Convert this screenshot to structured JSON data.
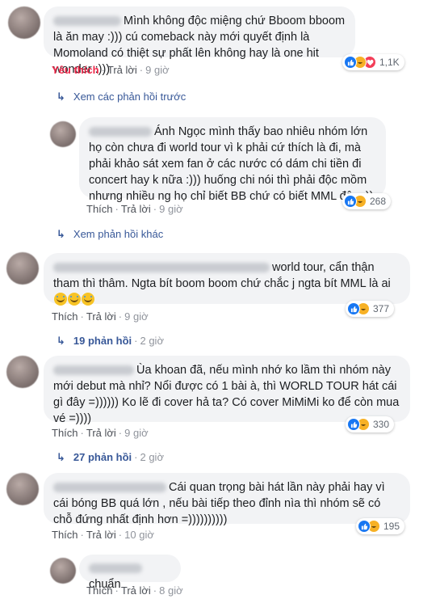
{
  "comments": [
    {
      "text": "Mình không độc miệng chứ Bboom bboom là ăn may :))) cú comeback này mới quyết định là Momoland có thiệt sự phất lên không hay là one hit wonder :)))",
      "actions": {
        "like": "Yêu thích",
        "reply": "Trả lời",
        "time": "9 giờ"
      },
      "reaction_count": "1,1K",
      "reaction_icons": [
        "like-icon",
        "haha-icon",
        "love-icon"
      ]
    },
    {
      "view_previous": "Xem các phản hồi trước"
    },
    {
      "text": "Ánh Ngọc mình thấy bao nhiêu nhóm lớn họ còn chưa đi world tour vì k phải cứ thích là đi, mà phải khảo sát xem fan ở các nước có dám chi tiền đi concert hay k nữa :))) huống chi nói thì phải độc mồm nhưng nhiều ng họ chỉ biết BB chứ có biết MML đâu :))",
      "actions": {
        "like": "Thích",
        "reply": "Trả lời",
        "time": "9 giờ"
      },
      "reaction_count": "268",
      "reaction_icons": [
        "like-icon",
        "haha-icon"
      ]
    },
    {
      "view_more": "Xem phản hồi khác"
    },
    {
      "text": "world tour, cẩn thận tham thì thâm. Ngta bít boom boom chứ chắc j ngta bít MML là ai",
      "actions": {
        "like": "Thích",
        "reply": "Trả lời",
        "time": "9 giờ"
      },
      "reaction_count": "377",
      "reaction_icons": [
        "like-icon",
        "haha-icon"
      ],
      "replies": {
        "label": "19 phản hồi",
        "time": "2 giờ"
      }
    },
    {
      "text": "Ùa khoan đã, nếu mình nhớ ko lầm thì nhóm này mới debut mà nhỉ? Nổi được có 1 bài à, thì WORLD TOUR hát cái gì đây =)))))) Ko lẽ đi cover hả ta? Có cover MiMiMi ko để còn mua vé =))))",
      "actions": {
        "like": "Thích",
        "reply": "Trả lời",
        "time": "9 giờ"
      },
      "reaction_count": "330",
      "reaction_icons": [
        "like-icon",
        "haha-icon"
      ],
      "replies": {
        "label": "27 phản hồi",
        "time": "2 giờ"
      }
    },
    {
      "text": "Cái quan trọng bài hát lần này phải hay vì cái bóng BB quá lớn , nếu bài tiếp theo đỉnh nìa thì nhóm sẽ có chỗ đứng nhất định hơn =))))))))))",
      "actions": {
        "like": "Thích",
        "reply": "Trả lời",
        "time": "10 giờ"
      },
      "reaction_count": "195",
      "reaction_icons": [
        "like-icon",
        "haha-icon"
      ]
    },
    {
      "text": "chuẩn",
      "actions": {
        "like": "Thích",
        "reply": "Trả lời",
        "time": "8 giờ"
      }
    }
  ],
  "separator": "·",
  "reply_arrow": "↳"
}
